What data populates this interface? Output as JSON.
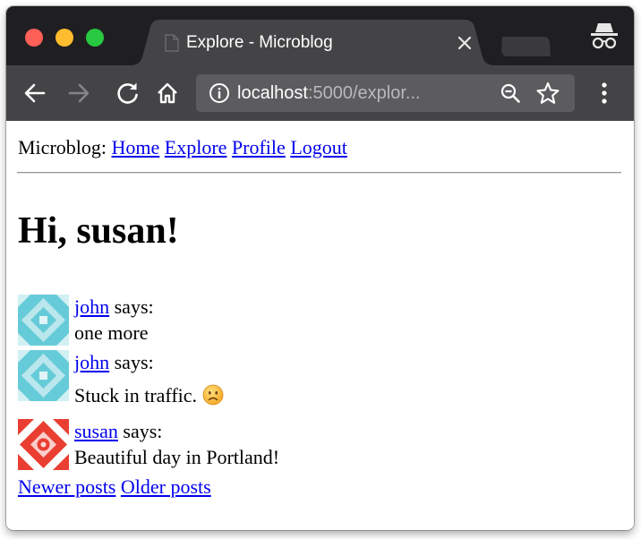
{
  "browser": {
    "tab_title": "Explore - Microblog",
    "url_host": "localhost",
    "url_rest": ":5000/explor..."
  },
  "nav": {
    "brand": "Microblog:",
    "links": [
      "Home",
      "Explore",
      "Profile",
      "Logout"
    ]
  },
  "greeting": "Hi, susan!",
  "posts": [
    {
      "author": "john",
      "says": "says:",
      "body": "one more",
      "avatar_color": "#66cbd8"
    },
    {
      "author": "john",
      "says": "says:",
      "body": "Stuck in traffic.",
      "emoji": "frowning-face",
      "avatar_color": "#66cbd8"
    },
    {
      "author": "susan",
      "says": "says:",
      "body": "Beautiful day in Portland!",
      "avatar_color": "#ea3e32"
    }
  ],
  "pagination": {
    "newer": "Newer posts",
    "older": "Older posts"
  },
  "colors": {
    "link": "#0000ee",
    "tabstrip": "#1f1f22",
    "toolbar": "#444446",
    "active_tab": "#444446",
    "omnibox": "#5c5c5f"
  }
}
